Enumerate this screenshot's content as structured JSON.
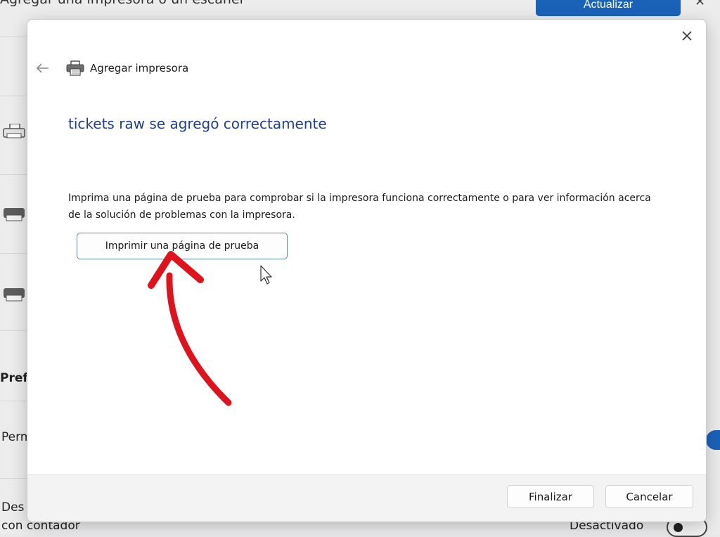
{
  "background": {
    "window_title": "Agregar una impresora o un escáner",
    "update_button": "Actualizar",
    "section_preferences": "Prefe",
    "setting_permission": "Perm",
    "setting_description": "Des",
    "setting_counter": "con contador",
    "setting_state": "Desactivado"
  },
  "dialog": {
    "header_title": "Agregar impresora",
    "success_heading": "tickets raw se agregó correctamente",
    "description": "Imprima una página de prueba para comprobar si la impresora funciona correctamente o para ver información acerca de la solución de problemas con la impresora.",
    "test_page_button": "Imprimir una página de prueba",
    "finish_button": "Finalizar",
    "cancel_button": "Cancelar"
  },
  "colors": {
    "heading": "#1f3f8f",
    "annotation_arrow": "#e0121b",
    "accent_blue": "#1a62b8"
  },
  "icons": {
    "back": "back-arrow-icon",
    "printer": "printer-icon",
    "close": "close-icon",
    "cursor": "mouse-cursor-icon"
  }
}
